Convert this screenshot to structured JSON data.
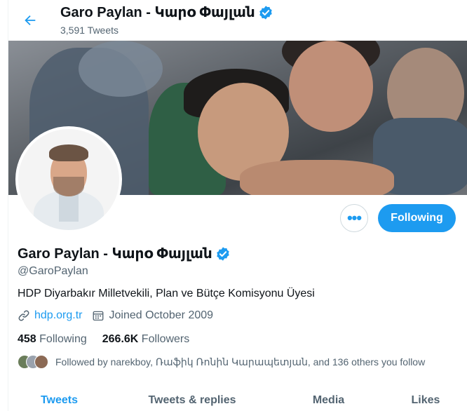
{
  "header": {
    "name": "Garo Paylan - Կարօ Փայլան",
    "tweet_count": "3,591 Tweets"
  },
  "profile": {
    "name": "Garo Paylan - Կարօ Փայլան",
    "handle": "@GaroPaylan",
    "bio": "HDP Diyarbakır Milletvekili, Plan ve Bütçe Komisyonu Üyesi",
    "website": "hdp.org.tr",
    "joined": "Joined October 2009",
    "following_count": "458",
    "following_label": "Following",
    "followers_count": "266.6K",
    "followers_label": "Followers",
    "followed_by": "Followed by narekboy, Ռաֆիկ Ռոնին Կարապետյան, and 136 others you follow"
  },
  "actions": {
    "more_label": "•••",
    "follow_label": "Following"
  },
  "tabs": [
    {
      "label": "Tweets",
      "active": true
    },
    {
      "label": "Tweets & replies",
      "active": false
    },
    {
      "label": "Media",
      "active": false
    },
    {
      "label": "Likes",
      "active": false
    }
  ],
  "colors": {
    "accent": "#1d9bf0",
    "text": "#0f1419",
    "secondary": "#536471"
  },
  "icons": {
    "back": "arrow-left-icon",
    "verified": "verified-badge-icon",
    "link": "link-icon",
    "calendar": "calendar-icon"
  }
}
